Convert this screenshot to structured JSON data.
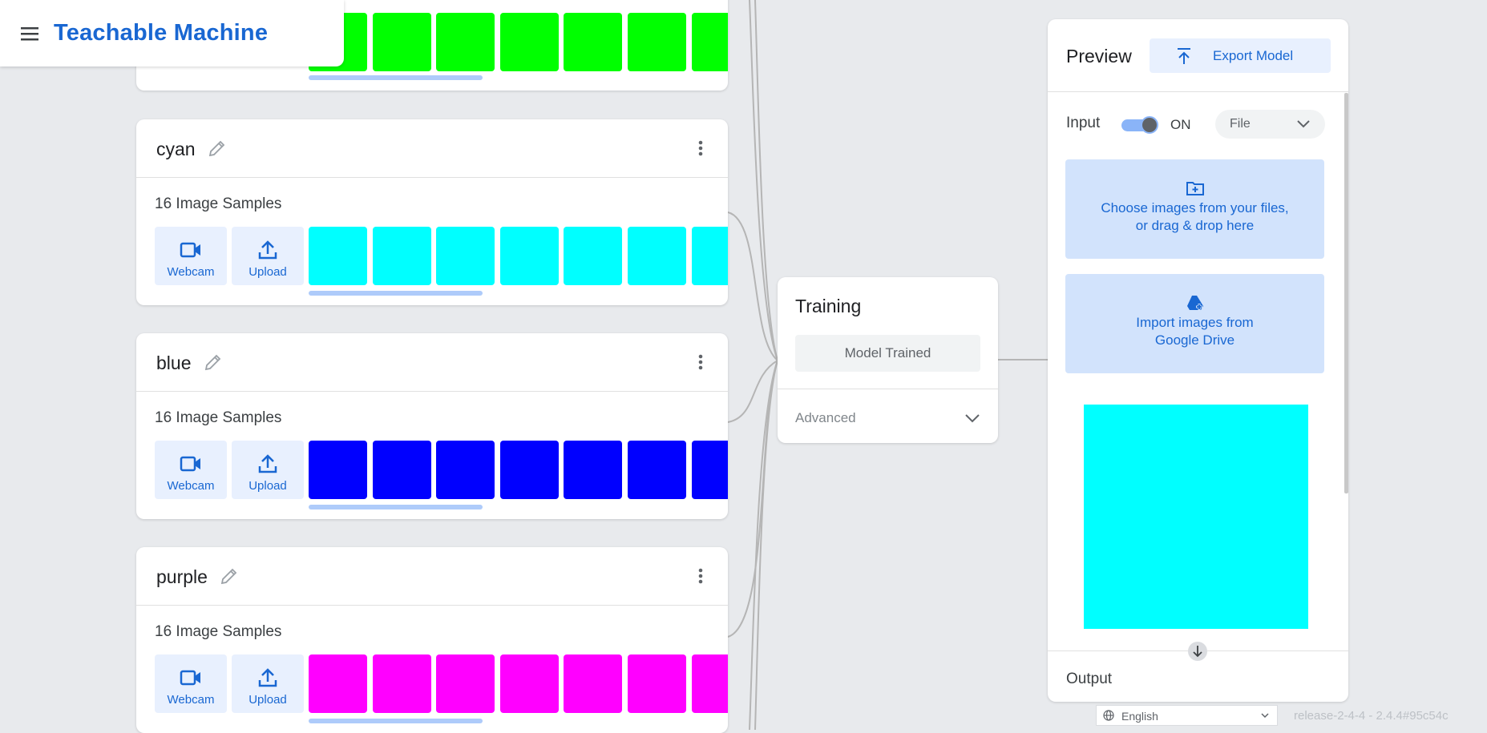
{
  "app": {
    "title": "Teachable Machine"
  },
  "colors": {
    "accent": "#1967d2",
    "green": "#00ff00",
    "cyan": "#00ffff",
    "blue": "#0000ff",
    "purple": "#ff00ff"
  },
  "classes": [
    {
      "name": "",
      "samples_label": "",
      "color": "#00ff00"
    },
    {
      "name": "cyan",
      "samples_label": "16 Image Samples",
      "color": "#00ffff",
      "webcam_label": "Webcam",
      "upload_label": "Upload"
    },
    {
      "name": "blue",
      "samples_label": "16 Image Samples",
      "color": "#0000ff",
      "webcam_label": "Webcam",
      "upload_label": "Upload"
    },
    {
      "name": "purple",
      "samples_label": "16 Image Samples",
      "color": "#ff00ff",
      "webcam_label": "Webcam",
      "upload_label": "Upload"
    }
  ],
  "training": {
    "title": "Training",
    "status_button": "Model Trained",
    "advanced_label": "Advanced"
  },
  "preview": {
    "title": "Preview",
    "export_button": "Export Model",
    "input_label": "Input",
    "toggle_state": "ON",
    "input_source": "File",
    "file_drop_text_1": "Choose images from your files,",
    "file_drop_text_2": "or drag & drop here",
    "drive_text_1": "Import images from",
    "drive_text_2": "Google Drive",
    "preview_color": "#00ffff",
    "output_label": "Output"
  },
  "footer": {
    "language": "English",
    "version": "release-2-4-4 - 2.4.4#95c54c"
  }
}
